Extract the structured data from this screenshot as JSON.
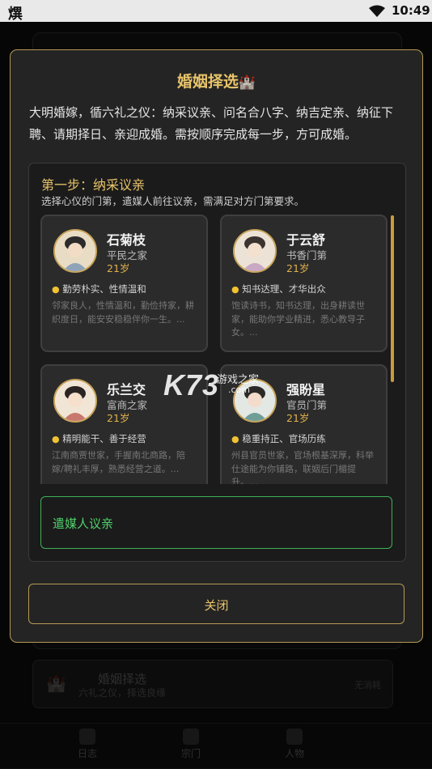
{
  "status_bar": {
    "app_icon": "熼",
    "time": "10:49"
  },
  "background": {
    "list_item": {
      "title": "婚姻择选",
      "subtitle": "六礼之仪，择选良缘",
      "tag": "无消耗"
    },
    "nav": [
      {
        "label": "日志"
      },
      {
        "label": "宗门"
      },
      {
        "label": "人物"
      }
    ]
  },
  "modal": {
    "title": "婚姻择选",
    "title_icon": "🏰",
    "intro": "大明婚嫁，循六礼之仪：纳采议亲、问名合八字、纳吉定亲、纳征下聘、请期择日、亲迎成婚。需按顺序完成每一步，方可成婚。",
    "step": {
      "title": "第一步：纳采议亲",
      "desc": "选择心仪的门第，遣媒人前往议亲，需满足对方门第要求。"
    },
    "candidates": [
      {
        "name": "石菊枝",
        "family": "平民之家",
        "age": "21岁",
        "traits": "勤劳朴实、性情温和",
        "desc": "邻家良人，性情温和，勤俭持家，耕织度日，能安安稳稳伴你一生。..."
      },
      {
        "name": "于云舒",
        "family": "书香门第",
        "age": "21岁",
        "traits": "知书达理、才华出众",
        "desc": "饱读诗书，知书达理，出身耕读世家，能助你学业精进，悉心教导子女。..."
      },
      {
        "name": "乐兰交",
        "family": "富商之家",
        "age": "21岁",
        "traits": "精明能干、善于经营",
        "desc": "江南商贾世家，手握南北商路，陪嫁/聘礼丰厚，熟悉经营之道。..."
      },
      {
        "name": "强盼星",
        "family": "官员门第",
        "age": "21岁",
        "traits": "稳重持正、官场历练",
        "desc": "州县官员世家，官场根基深厚，科举仕途能为你铺路，联姻后门楣提升。..."
      }
    ],
    "action_button": "遣媒人议亲",
    "close_button": "关闭"
  },
  "watermark": {
    "logo": "K73",
    "sub": "游戏之家",
    "domain": ".com"
  },
  "colors": {
    "accent_gold": "#e8c46a",
    "border_gold": "#b59a55",
    "action_green": "#4fd06a"
  }
}
